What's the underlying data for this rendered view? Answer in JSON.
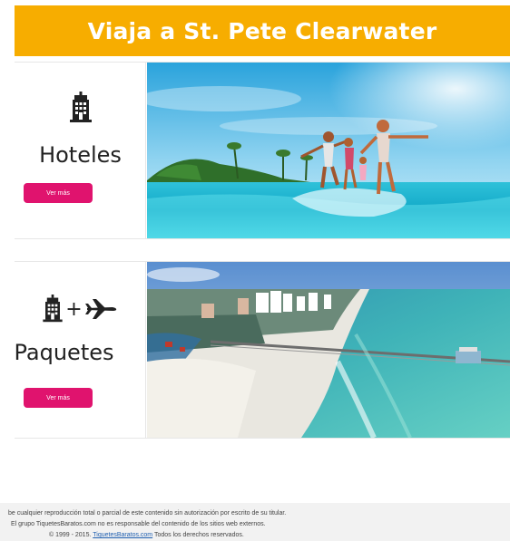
{
  "banner": {
    "title": "Viaja a St. Pete Clearwater"
  },
  "cards": [
    {
      "title": "Hoteles",
      "button": "Ver más",
      "icons": [
        "hotel-icon"
      ]
    },
    {
      "title": "Paquetes",
      "button": "Ver más",
      "icons": [
        "hotel-icon",
        "airplane-icon"
      ],
      "joiner": "+"
    }
  ],
  "footer": {
    "line1": "be cualquier reproducción total o parcial de este contenido sin autorización por escrito de su titular.",
    "line2": "El grupo TiquetesBaratos.com no es responsable del contenido de los sitios web externos.",
    "line3_prefix": "© 1999 - 2015.",
    "line3_link": "TiquetesBaratos.com",
    "line3_suffix": "Todos los derechos reservados."
  },
  "colors": {
    "banner": "#f7ad00",
    "button": "#e0136e",
    "link": "#1f5fb0"
  }
}
